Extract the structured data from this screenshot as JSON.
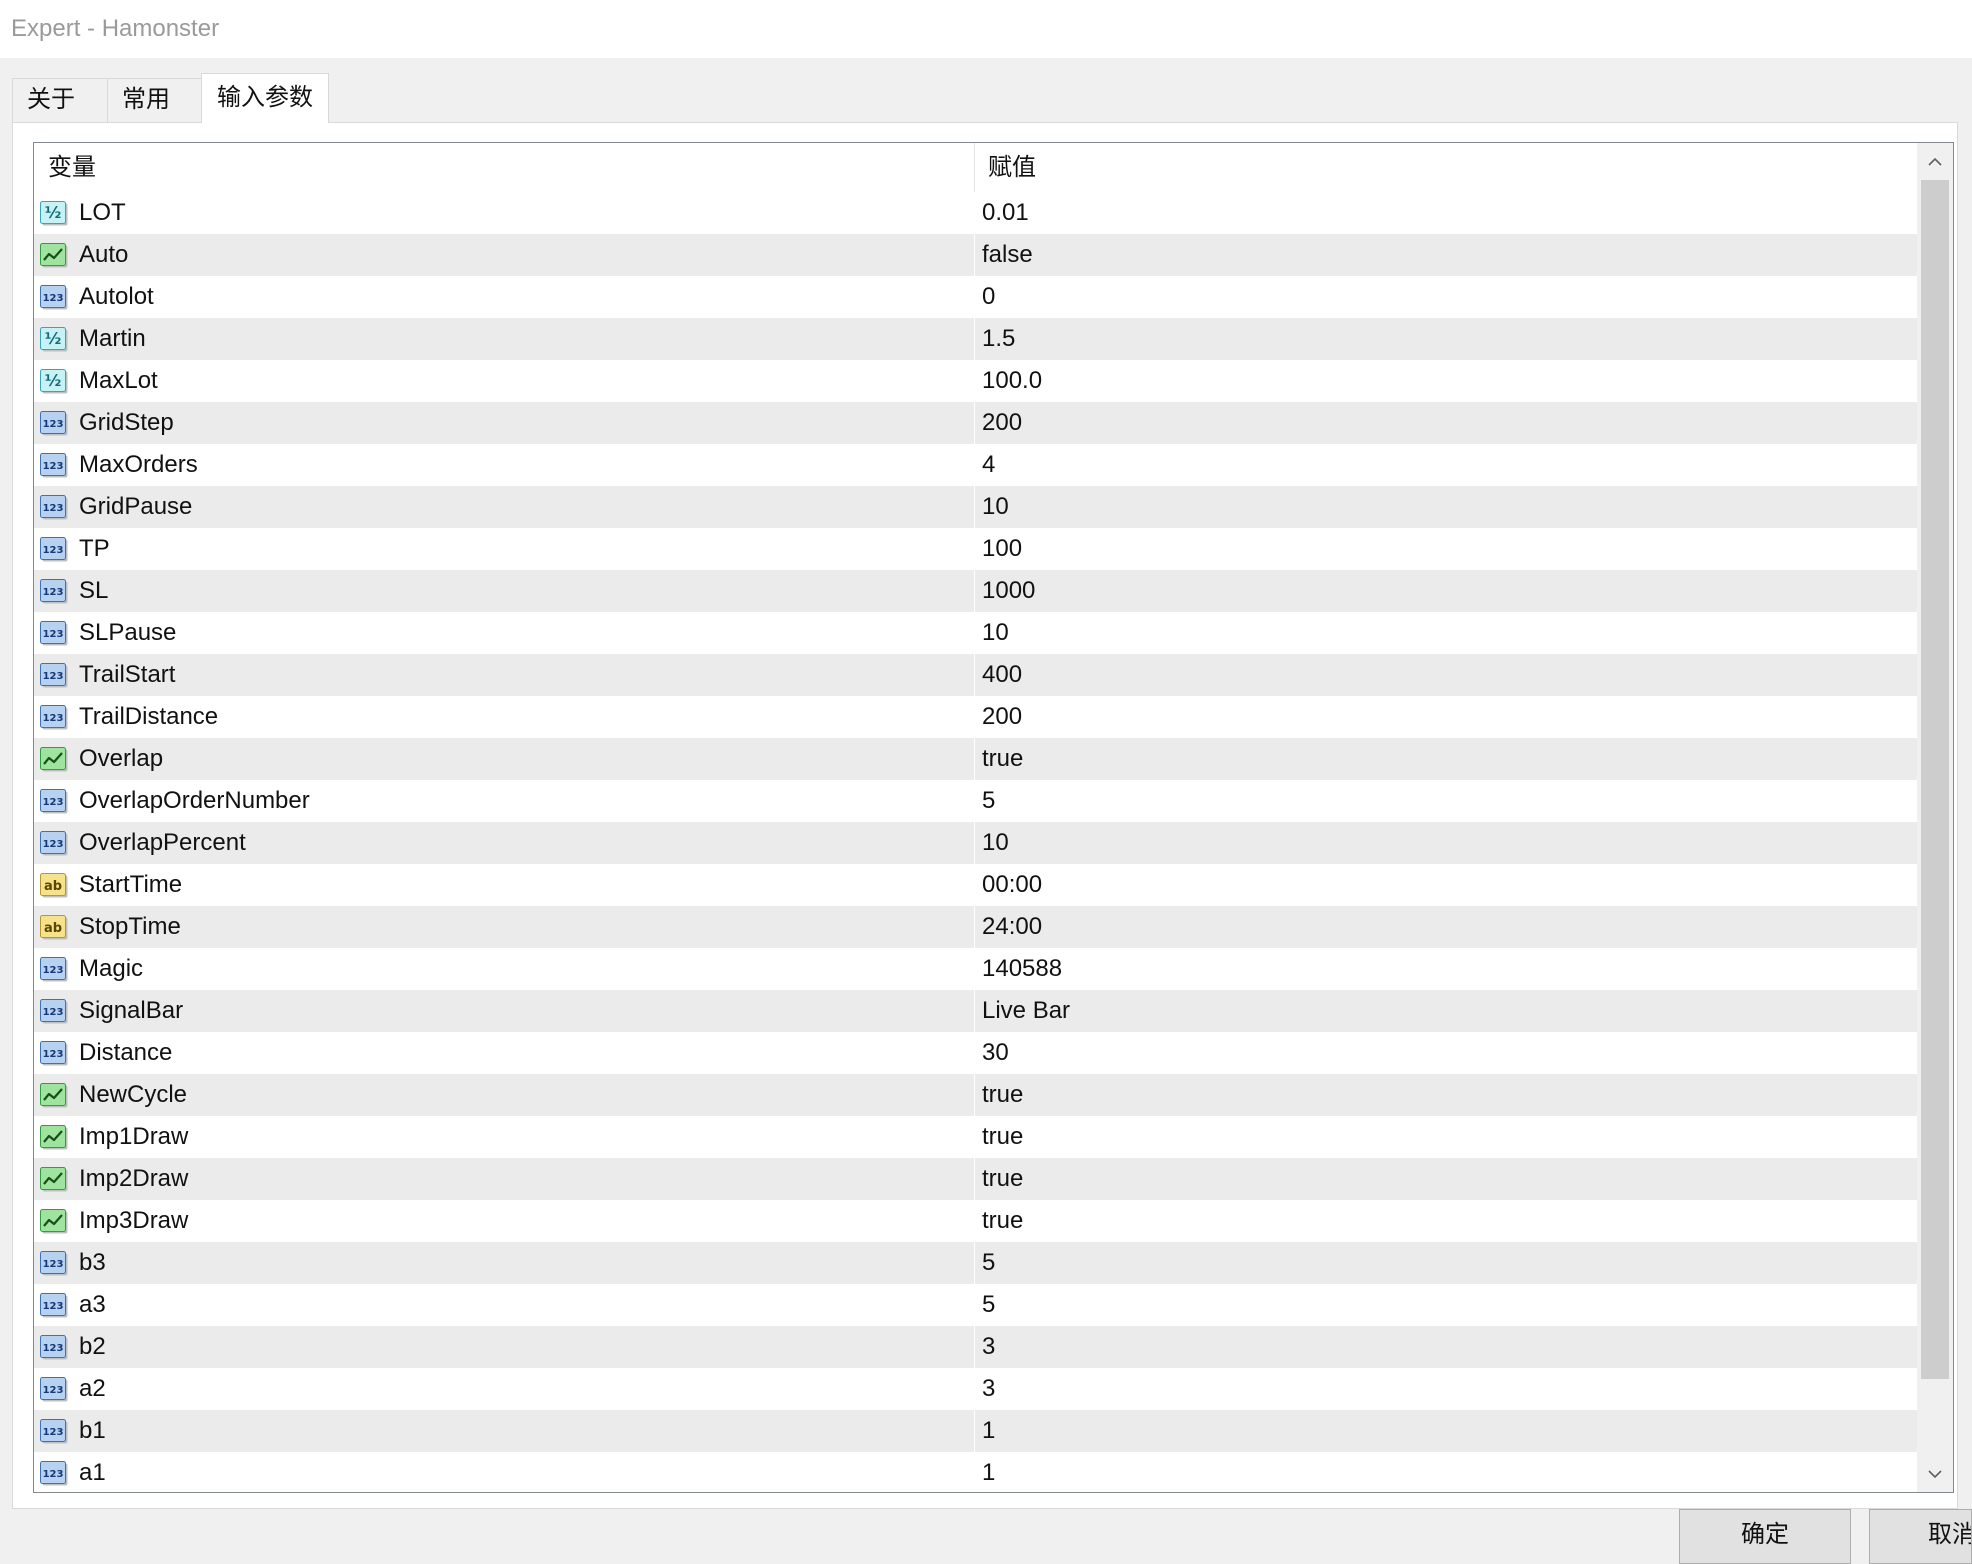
{
  "window": {
    "title": "Expert - Hamonster"
  },
  "tabs": [
    {
      "label": "关于",
      "active": false
    },
    {
      "label": "常用",
      "active": false
    },
    {
      "label": "输入参数",
      "active": true
    }
  ],
  "table": {
    "headers": {
      "variable": "变量",
      "value": "赋值"
    },
    "rows": [
      {
        "name": "LOT",
        "value": "0.01",
        "icon": "double-icon"
      },
      {
        "name": "Auto",
        "value": "false",
        "icon": "bool-icon"
      },
      {
        "name": "Autolot",
        "value": "0",
        "icon": "int-icon"
      },
      {
        "name": "Martin",
        "value": "1.5",
        "icon": "double-icon"
      },
      {
        "name": "MaxLot",
        "value": "100.0",
        "icon": "double-icon"
      },
      {
        "name": "GridStep",
        "value": "200",
        "icon": "int-icon"
      },
      {
        "name": "MaxOrders",
        "value": "4",
        "icon": "int-icon"
      },
      {
        "name": "GridPause",
        "value": "10",
        "icon": "int-icon"
      },
      {
        "name": "TP",
        "value": "100",
        "icon": "int-icon"
      },
      {
        "name": "SL",
        "value": "1000",
        "icon": "int-icon"
      },
      {
        "name": "SLPause",
        "value": "10",
        "icon": "int-icon"
      },
      {
        "name": "TrailStart",
        "value": "400",
        "icon": "int-icon"
      },
      {
        "name": "TrailDistance",
        "value": "200",
        "icon": "int-icon"
      },
      {
        "name": "Overlap",
        "value": "true",
        "icon": "bool-icon"
      },
      {
        "name": "OverlapOrderNumber",
        "value": "5",
        "icon": "int-icon"
      },
      {
        "name": "OverlapPercent",
        "value": "10",
        "icon": "int-icon"
      },
      {
        "name": "StartTime",
        "value": "00:00",
        "icon": "string-icon"
      },
      {
        "name": "StopTime",
        "value": "24:00",
        "icon": "string-icon"
      },
      {
        "name": "Magic",
        "value": "140588",
        "icon": "int-icon"
      },
      {
        "name": "SignalBar",
        "value": "Live Bar",
        "icon": "int-icon"
      },
      {
        "name": "Distance",
        "value": "30",
        "icon": "int-icon"
      },
      {
        "name": "NewCycle",
        "value": "true",
        "icon": "bool-icon"
      },
      {
        "name": "Imp1Draw",
        "value": "true",
        "icon": "bool-icon"
      },
      {
        "name": "Imp2Draw",
        "value": "true",
        "icon": "bool-icon"
      },
      {
        "name": "Imp3Draw",
        "value": "true",
        "icon": "bool-icon"
      },
      {
        "name": "b3",
        "value": "5",
        "icon": "int-icon"
      },
      {
        "name": "a3",
        "value": "5",
        "icon": "int-icon"
      },
      {
        "name": "b2",
        "value": "3",
        "icon": "int-icon"
      },
      {
        "name": "a2",
        "value": "3",
        "icon": "int-icon"
      },
      {
        "name": "b1",
        "value": "1",
        "icon": "int-icon"
      },
      {
        "name": "a1",
        "value": "1",
        "icon": "int-icon"
      }
    ]
  },
  "icon_types": {
    "double-icon": {
      "glyph": "½",
      "fill": "#c6f1f5",
      "stroke": "#35a7b8",
      "ink": "#136b78"
    },
    "bool-icon": {
      "fill": "#9ee39e",
      "stroke": "#2f9e3f",
      "ink": "#1b4d1b"
    },
    "int-icon": {
      "glyph": "123",
      "fill": "#b7d1f0",
      "stroke": "#3d72b8",
      "ink": "#17387a"
    },
    "string-icon": {
      "glyph": "ab",
      "fill": "#f5e28a",
      "stroke": "#b8982a",
      "ink": "#5b4600"
    }
  },
  "scrollbar": {
    "position": 0,
    "thumb_fraction": 0.94
  },
  "buttons": {
    "ok": "确定",
    "cancel": "取消"
  },
  "colors": {
    "row_alt": "#ebebeb",
    "row": "#ffffff",
    "frame_border": "#828790"
  }
}
